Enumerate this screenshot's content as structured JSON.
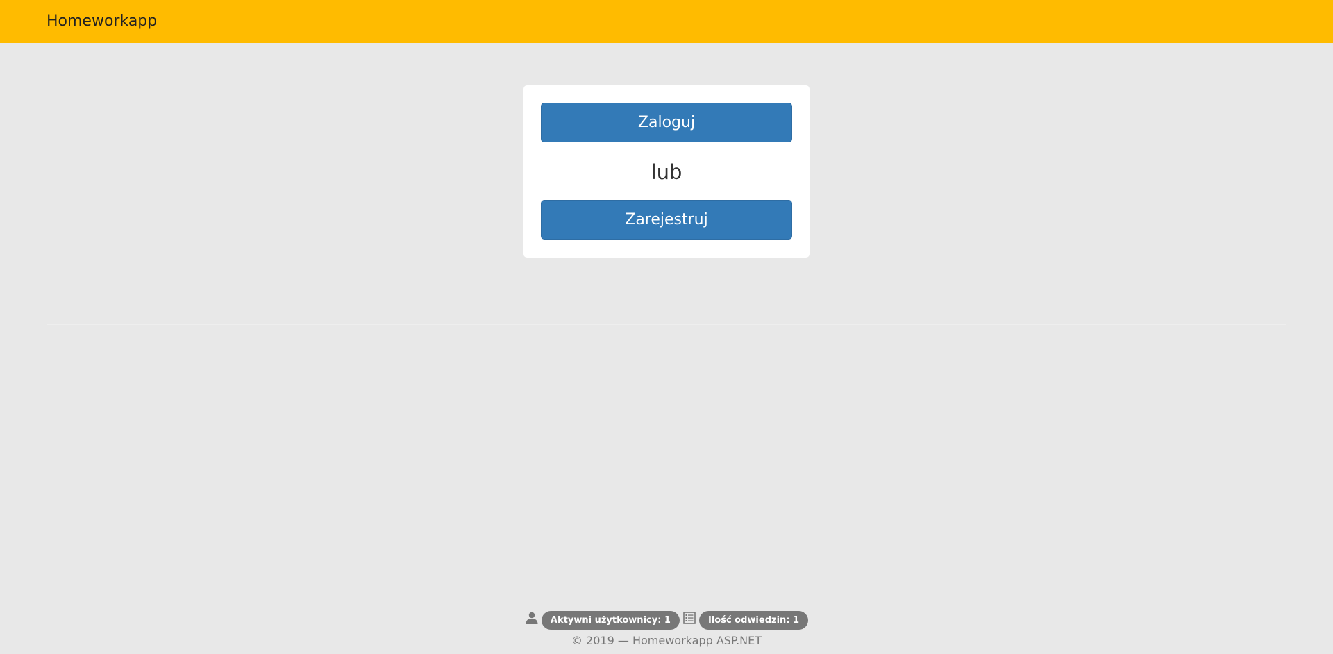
{
  "app": {
    "brand": "Homeworkapp"
  },
  "colors": {
    "navbar": "#ffbb00",
    "page_background": "#e8e8e8",
    "primary_button": "#337ab7",
    "badge": "#777777"
  },
  "auth_panel": {
    "login_label": "Zaloguj",
    "or_text": "lub",
    "register_label": "Zarejestruj"
  },
  "footer": {
    "active_users_icon": "user-icon",
    "active_users": "Aktywni użytkownicy: 1",
    "visits_icon": "list-alt-icon",
    "visits": "Ilość odwiedzin: 1",
    "copyright": "© 2019 — Homeworkapp ASP.NET"
  }
}
